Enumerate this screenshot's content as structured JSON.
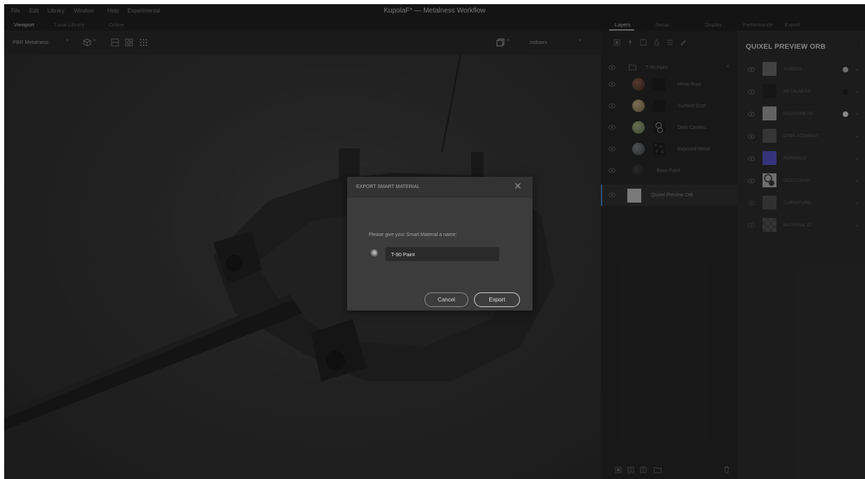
{
  "menu": {
    "items": [
      "File",
      "Edit",
      "Library",
      "Window",
      "Help",
      "Experimental"
    ],
    "title": "KupolaF* — Metalness Workflow"
  },
  "left_tabs": [
    "Viewport",
    "Local Library",
    "Online"
  ],
  "right_tabs": [
    "Layers",
    "Setup",
    "Display",
    "Performance",
    "Export"
  ],
  "viewport_toolbar": {
    "workflow": "PBR Metalness",
    "environment": "Indoors",
    "icons": [
      "cube-icon",
      "single-view-icon",
      "split-view-icon",
      "grid-view-icon",
      "window-icon"
    ]
  },
  "layers": {
    "toolbar_icons": [
      "new-layer-icon",
      "brush-icon",
      "square-icon",
      "drop-icon",
      "lines-icon",
      "pen-icon"
    ],
    "group": "T-90 Paint",
    "items": [
      {
        "label": "Metal Rust",
        "ball_color": "#5a3a2a"
      },
      {
        "label": "Surface Dust",
        "ball_color": "#8a7a5a"
      },
      {
        "label": "Dark Cavities",
        "ball_color": "#6e7a5a"
      },
      {
        "label": "Exposed Metal",
        "ball_color": "#4a4f52"
      },
      {
        "label": "Base Paint",
        "ball_color": "#2c2c2c"
      },
      {
        "label": "Quixel Preview Orb",
        "ball_color": "#b9b9b9"
      }
    ],
    "bottom_icons": [
      "add-layer-icon",
      "mask-icon",
      "split-icon",
      "folder-icon",
      "trash-icon"
    ]
  },
  "orb_panel": {
    "title": "QUIXEL PREVIEW ORB",
    "channels": [
      {
        "label": "ALBEDO",
        "swatch": "#5c5c5c",
        "dot": "#9a9a9a"
      },
      {
        "label": "METALNESS",
        "swatch": "#1f1f1f",
        "dot": "#181818"
      },
      {
        "label": "ROUGHNESS",
        "swatch": "#8a8a8a",
        "dot": "#bdbdbd"
      },
      {
        "label": "DISPLACEMENT",
        "swatch": "#4a4a4a",
        "dot": ""
      },
      {
        "label": "NORMALS",
        "swatch": "#4a48a8",
        "dot": ""
      },
      {
        "label": "OCCLUSION",
        "swatch": "#9a9a9a",
        "dot": ""
      },
      {
        "label": "CURVATURE",
        "swatch": "#444444",
        "dot": ""
      },
      {
        "label": "MATERIAL ID",
        "swatch": "#3e3e3e",
        "dot": ""
      }
    ]
  },
  "dialog": {
    "title": "EXPORT SMART MATERIAL",
    "prompt": "Please give your Smart Material a name:",
    "name_value": "T-90 Paint",
    "cancel_label": "Cancel",
    "export_label": "Export"
  }
}
